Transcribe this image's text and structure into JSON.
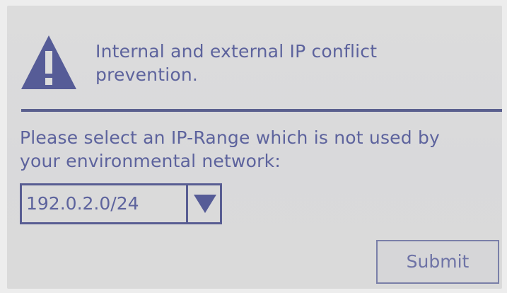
{
  "dialog": {
    "header_line1": "Internal and external IP conflict",
    "header_line2": "prevention.",
    "instruction_line1": "Please select an IP-Range which is not used by",
    "instruction_line2": "your environmental network:",
    "ip_range_select": {
      "selected_value": "192.0.2.0/24"
    },
    "submit_label": "Submit"
  },
  "icons": {
    "warning": "warning-icon",
    "dropdown": "chevron-down-icon"
  },
  "colors": {
    "screen_background": "#d9d9db",
    "text": "#5d639d",
    "accent": "#585d92"
  }
}
